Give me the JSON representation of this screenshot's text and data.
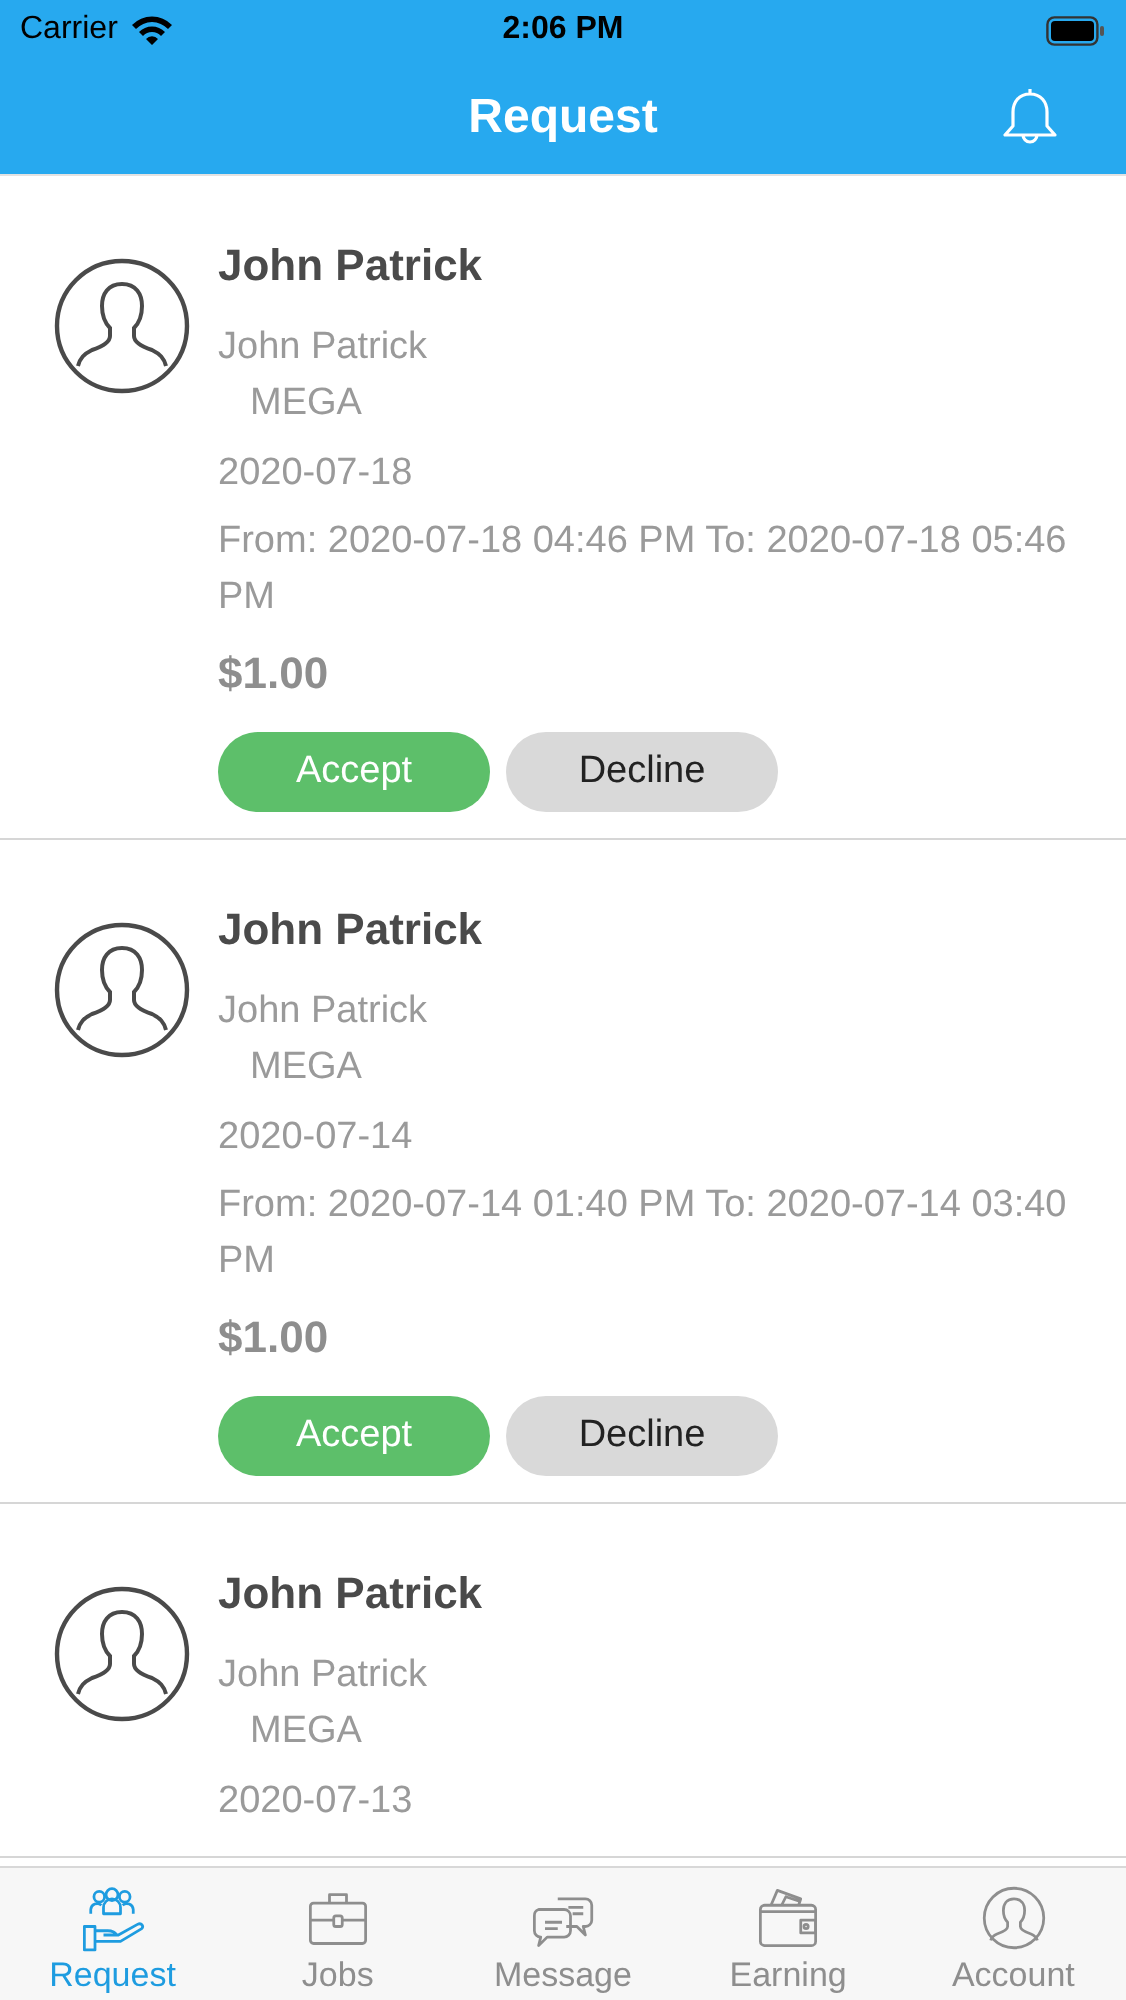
{
  "status_bar": {
    "carrier": "Carrier",
    "time": "2:06 PM"
  },
  "nav_bar": {
    "title": "Request"
  },
  "requests": [
    {
      "name": "John Patrick",
      "customer": "John Patrick",
      "company": "MEGA",
      "date": "2020-07-18",
      "period": "From: 2020-07-18 04:46 PM To: 2020-07-18 05:46 PM",
      "price": "$1.00",
      "accept": "Accept",
      "decline": "Decline"
    },
    {
      "name": "John Patrick",
      "customer": "John Patrick",
      "company": "MEGA",
      "date": "2020-07-14",
      "period": "From: 2020-07-14 01:40 PM To: 2020-07-14 03:40 PM",
      "price": "$1.00",
      "accept": "Accept",
      "decline": "Decline"
    },
    {
      "name": "John Patrick",
      "customer": "John Patrick",
      "company": "MEGA",
      "date": "2020-07-13"
    }
  ],
  "tab_bar": [
    {
      "kind": "request",
      "label": "Request",
      "selected": true
    },
    {
      "kind": "jobs",
      "label": "Jobs",
      "selected": false
    },
    {
      "kind": "message",
      "label": "Message",
      "selected": false
    },
    {
      "kind": "earning",
      "label": "Earning",
      "selected": false
    },
    {
      "kind": "account",
      "label": "Account",
      "selected": false
    }
  ]
}
